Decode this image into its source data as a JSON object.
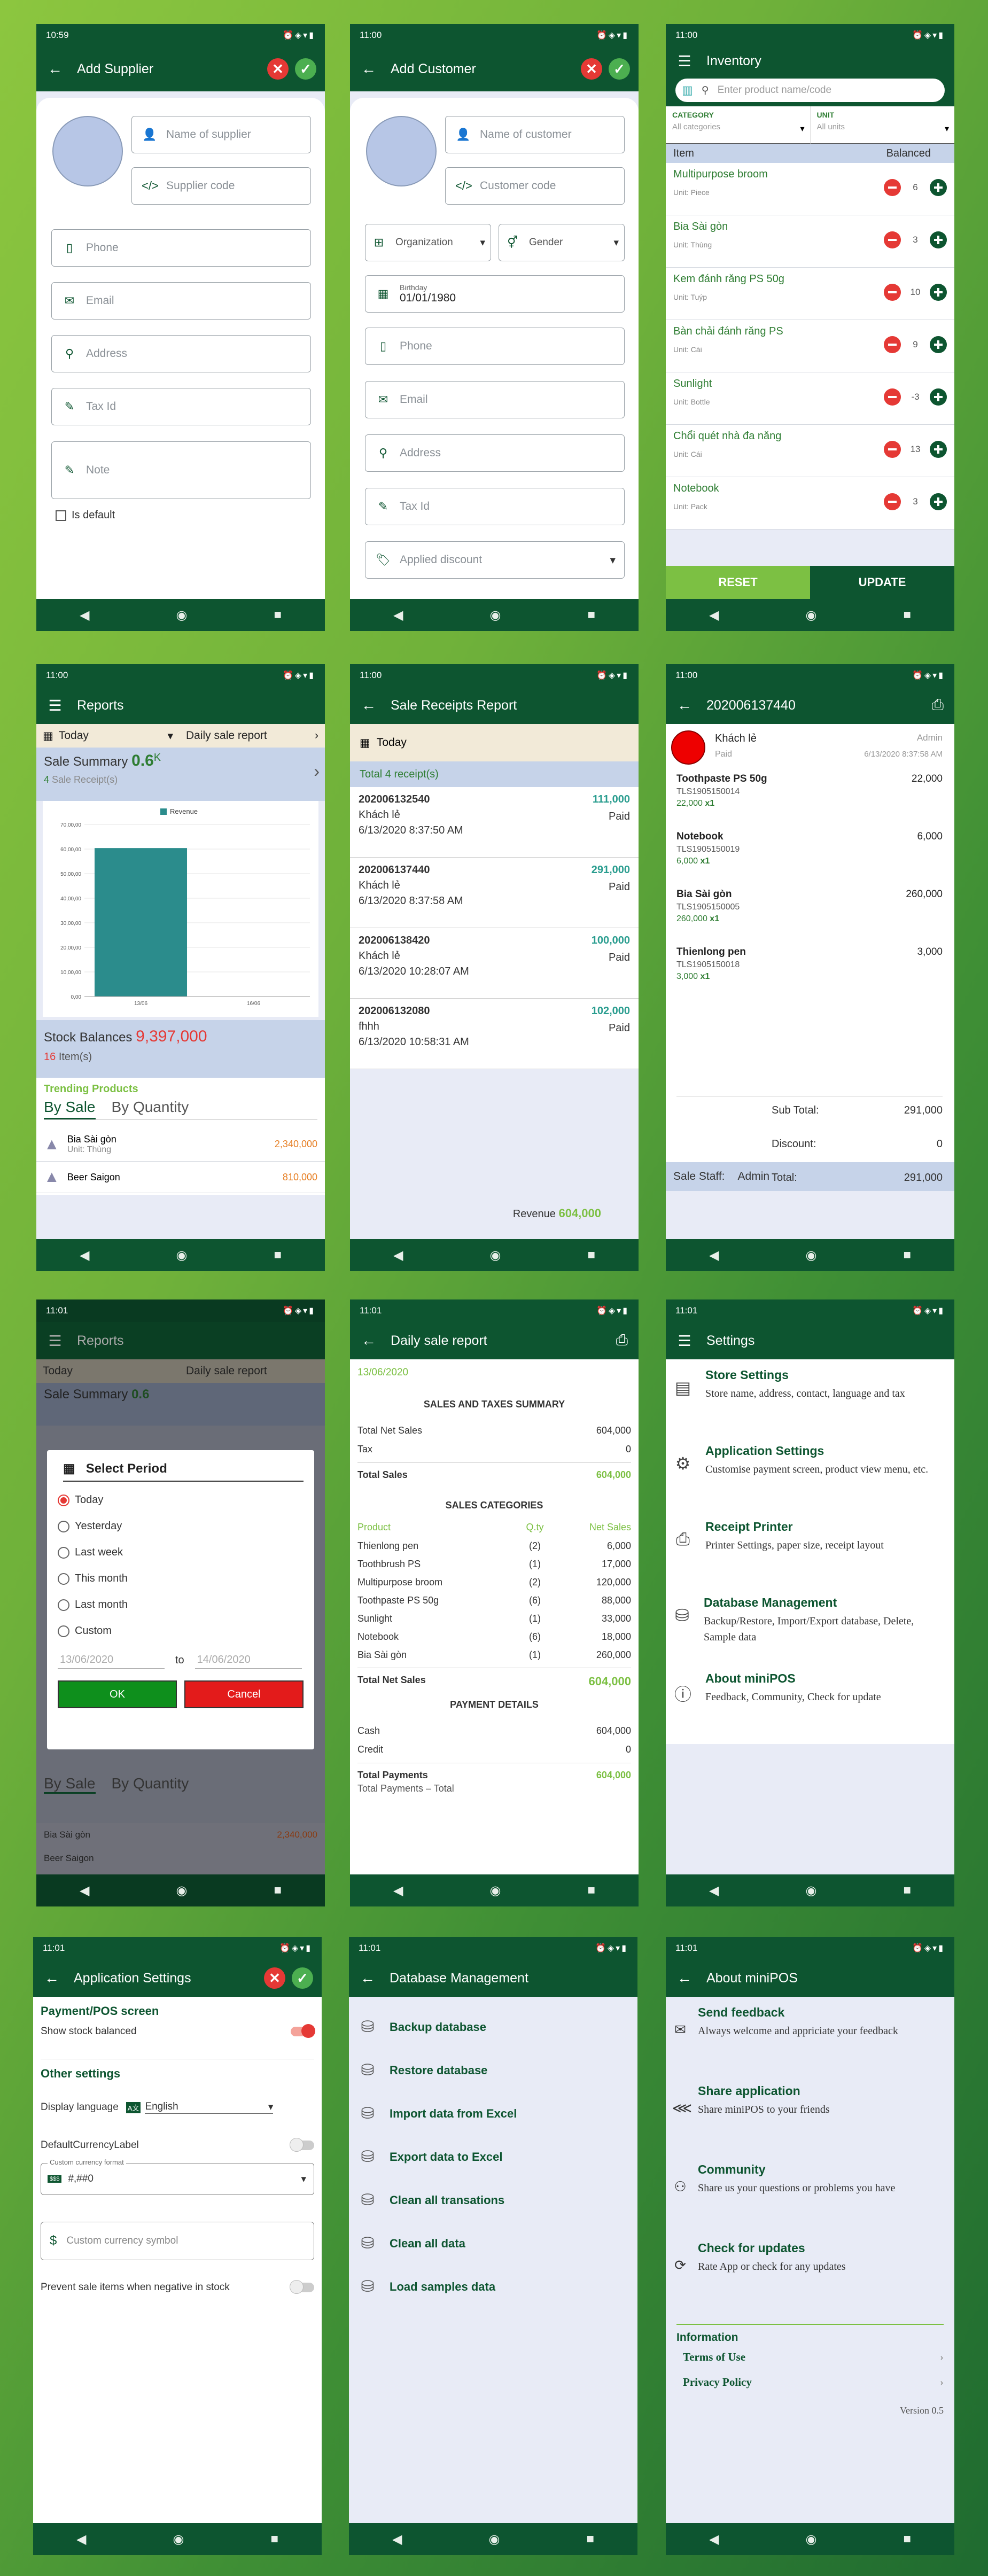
{
  "time1": "10:59",
  "time2": "11:00",
  "time3": "11:01",
  "s1": {
    "title": "Add Supplier",
    "name": "Name of supplier",
    "code": "Supplier code",
    "phone": "Phone",
    "email": "Email",
    "address": "Address",
    "tax": "Tax Id",
    "note": "Note",
    "default": "Is default"
  },
  "s2": {
    "title": "Add Customer",
    "name": "Name of customer",
    "code": "Customer code",
    "org": "Organization",
    "gender": "Gender",
    "bday_label": "Birthday",
    "bday": "01/01/1980",
    "phone": "Phone",
    "email": "Email",
    "address": "Address",
    "tax": "Tax Id",
    "discount": "Applied discount"
  },
  "s3": {
    "title": "Inventory",
    "search": "Enter product name/code",
    "cat_label": "CATEGORY",
    "cat_val": "All categories",
    "unit_label": "UNIT",
    "unit_val": "All units",
    "col_item": "Item",
    "col_bal": "Balanced",
    "unit_prefix": "Unit:",
    "items": [
      {
        "name": "Multipurpose broom",
        "unit": "Piece",
        "qty": "6"
      },
      {
        "name": "Bia Sài gòn",
        "unit": "Thùng",
        "qty": "3"
      },
      {
        "name": "Kem đánh răng PS 50g",
        "unit": "Tuýp",
        "qty": "10"
      },
      {
        "name": "Bàn chải đánh răng PS",
        "unit": "Cái",
        "qty": "9"
      },
      {
        "name": "Sunlight",
        "unit": "Bottle",
        "qty": "-3"
      },
      {
        "name": "Chổi quét nhà đa năng",
        "unit": "Cái",
        "qty": "13"
      },
      {
        "name": "Notebook",
        "unit": "Pack",
        "qty": "3"
      }
    ],
    "reset": "RESET",
    "update": "UPDATE"
  },
  "s4": {
    "title": "Reports",
    "period": "Today",
    "report": "Daily sale report",
    "summary": "Sale Summary",
    "sum_val": "0.6",
    "sum_unit": "K",
    "receipts_n": "4",
    "receipts_lbl": "Sale Receipt(s)",
    "stock_lbl": "Stock Balances",
    "stock_val": "9,397,000",
    "items_n": "16",
    "items_lbl": "Item(s)",
    "trending": "Trending Products",
    "tab1": "By Sale",
    "tab2": "By Quantity",
    "products": [
      {
        "name": "Bia Sài gòn",
        "unit": "Unit: Thùng",
        "val": "2,340,000"
      },
      {
        "name": "Beer Saigon",
        "unit": "",
        "val": "810,000"
      }
    ]
  },
  "chart_data": {
    "type": "bar",
    "categories": [
      "13/06",
      "16/06"
    ],
    "series": [
      {
        "name": "Revenue",
        "values": [
          604000,
          0
        ]
      }
    ],
    "ylim": [
      0,
      700000
    ],
    "yticks": [
      "0,00",
      "10,00,00",
      "20,00,00",
      "30,00,00",
      "40,00,00",
      "50,00,00",
      "60,00,00",
      "70,00,00"
    ],
    "legend": "top"
  },
  "s5": {
    "title": "Sale Receipts Report",
    "period": "Today",
    "total": "Total 4 receipt(s)",
    "rev_lbl": "Revenue",
    "rev": "604,000",
    "receipts": [
      {
        "id": "202006132540",
        "amt": "111,000",
        "cust": "Khách lẻ",
        "st": "Paid",
        "dt": "6/13/2020 8:37:50 AM"
      },
      {
        "id": "202006137440",
        "amt": "291,000",
        "cust": "Khách lẻ",
        "st": "Paid",
        "dt": "6/13/2020 8:37:58 AM"
      },
      {
        "id": "202006138420",
        "amt": "100,000",
        "cust": "Khách lẻ",
        "st": "Paid",
        "dt": "6/13/2020 10:28:07 AM"
      },
      {
        "id": "202006132080",
        "amt": "102,000",
        "cust": "fhhh",
        "st": "Paid",
        "dt": "6/13/2020 10:58:31 AM"
      }
    ]
  },
  "s6": {
    "title": "202006137440",
    "cust": "Khách lẻ",
    "user": "Admin",
    "status": "Paid",
    "dt": "6/13/2020 8:37:58 AM",
    "lines": [
      {
        "name": "Toothpaste PS 50g",
        "code": "TLS1905150014",
        "price": "22,000",
        "qty": "x1",
        "total": "22,000"
      },
      {
        "name": "Notebook",
        "code": "TLS1905150019",
        "price": "6,000",
        "qty": "x1",
        "total": "6,000"
      },
      {
        "name": "Bia Sài gòn",
        "code": "TLS1905150005",
        "price": "260,000",
        "qty": "x1",
        "total": "260,000"
      },
      {
        "name": "Thienlong pen",
        "code": "TLS1905150018",
        "price": "3,000",
        "qty": "x1",
        "total": "3,000"
      }
    ],
    "sub_lbl": "Sub Total:",
    "sub": "291,000",
    "disc_lbl": "Discount:",
    "disc": "0",
    "tot_lbl": "Total:",
    "tot": "291,000",
    "staff_lbl": "Sale Staff:",
    "staff": "Admin"
  },
  "s7": {
    "dlg_title": "Select Period",
    "opts": [
      "Today",
      "Yesterday",
      "Last week",
      "This month",
      "Last month",
      "Custom"
    ],
    "from": "13/06/2020",
    "to_lbl": "to",
    "to": "14/06/2020",
    "ok": "OK",
    "cancel": "Cancel"
  },
  "s8": {
    "title": "Daily sale report",
    "date": "13/06/2020",
    "h1": "SALES AND TAXES SUMMARY",
    "net_lbl": "Total Net Sales",
    "net": "604,000",
    "tax_lbl": "Tax",
    "tax": "0",
    "ts_lbl": "Total Sales",
    "ts": "604,000",
    "h2": "SALES CATEGORIES",
    "c_prod": "Product",
    "c_qty": "Q.ty",
    "c_net": "Net Sales",
    "cats": [
      {
        "p": "Thienlong pen",
        "q": "(2)",
        "n": "6,000"
      },
      {
        "p": "Toothbrush PS",
        "q": "(1)",
        "n": "17,000"
      },
      {
        "p": "Multipurpose broom",
        "q": "(2)",
        "n": "120,000"
      },
      {
        "p": "Toothpaste PS 50g",
        "q": "(6)",
        "n": "88,000"
      },
      {
        "p": "Sunlight",
        "q": "(1)",
        "n": "33,000"
      },
      {
        "p": "Notebook",
        "q": "(6)",
        "n": "18,000"
      },
      {
        "p": "Bia Sài gòn",
        "q": "(1)",
        "n": "260,000"
      }
    ],
    "tn_lbl": "Total Net Sales",
    "tn": "604,000",
    "h3": "PAYMENT DETAILS",
    "cash_lbl": "Cash",
    "cash": "604,000",
    "credit_lbl": "Credit",
    "credit": "0",
    "tp_lbl": "Total Payments",
    "tp": "604,000",
    "tpt": "Total Payments – Total"
  },
  "s9": {
    "title": "Settings",
    "items": [
      {
        "t": "Store Settings",
        "d": "Store name, address, contact, language and tax"
      },
      {
        "t": "Application Settings",
        "d": "Customise payment screen, product view menu, etc."
      },
      {
        "t": "Receipt Printer",
        "d": "Printer Settings, paper size, receipt layout"
      },
      {
        "t": "Database Management",
        "d": "Backup/Restore, Import/Export database, Delete, Sample data"
      },
      {
        "t": "About miniPOS",
        "d": "Feedback, Community, Check for update"
      }
    ]
  },
  "s10": {
    "title": "Application Settings",
    "sec1": "Payment/POS screen",
    "stock": "Show stock balanced",
    "sec2": "Other settings",
    "lang_lbl": "Display language",
    "lang_badge": "A文",
    "lang": "English",
    "cur_lbl": "DefaultCurrencyLabel",
    "fmt_lbl": "Custom currency format",
    "fmt_badge": "$$$",
    "fmt": "#,##0",
    "sym": "Custom currency symbol",
    "neg": "Prevent sale items when negative in stock"
  },
  "s11": {
    "title": "Database Management",
    "items": [
      "Backup database",
      "Restore database",
      "Import data from Excel",
      "Export data to Excel",
      "Clean all transations",
      "Clean all data",
      "Load samples data"
    ]
  },
  "s12": {
    "title": "About miniPOS",
    "items": [
      {
        "t": "Send feedback",
        "d": "Always welcome and appriciate your feedback"
      },
      {
        "t": "Share application",
        "d": "Share miniPOS to your friends"
      },
      {
        "t": "Community",
        "d": "Share us your questions or problems you have"
      },
      {
        "t": "Check for updates",
        "d": "Rate App or check for any updates"
      }
    ],
    "info": "Information",
    "terms": "Terms of Use",
    "privacy": "Privacy Policy",
    "version": "Version 0.5"
  }
}
